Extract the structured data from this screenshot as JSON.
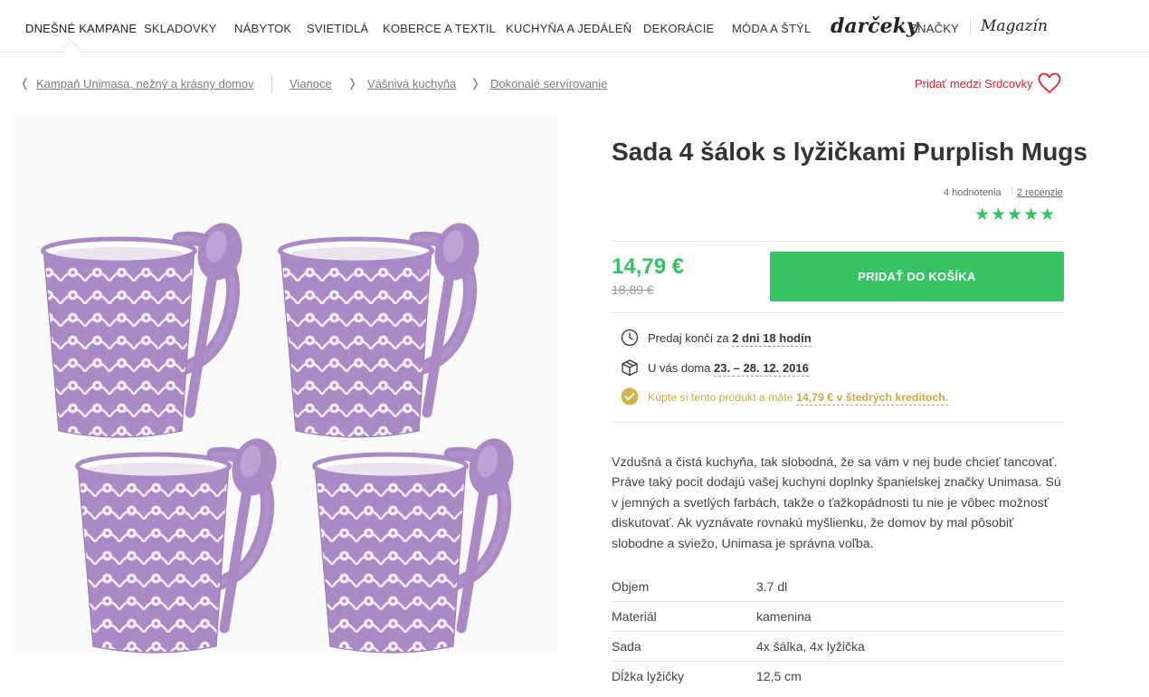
{
  "nav": {
    "items": [
      {
        "label": "DNEŠNÉ KAMPANE"
      },
      {
        "label": "SKLADOVKY"
      },
      {
        "label": "NÁBYTOK"
      },
      {
        "label": "SVIETIDLÁ"
      },
      {
        "label": "KOBERCE A TEXTIL"
      },
      {
        "label": "KUCHYŇA A JEDÁLEŇ"
      },
      {
        "label": "DEKORÁCIE"
      },
      {
        "label": "MÓDA A ŠTÝL"
      },
      {
        "label": "darčeky"
      },
      {
        "label": "ZNAČKY"
      },
      {
        "label": "Magazín"
      }
    ]
  },
  "breadcrumb": {
    "items": [
      {
        "label": "Kampaň Unimasa, nežný a krásny domov"
      },
      {
        "label": "Vianoce"
      },
      {
        "label": "Vášnivá kuchyňa"
      },
      {
        "label": "Dokonalé servírovanie"
      }
    ],
    "favorite_label": "Pridať medzi Srdcovky"
  },
  "product": {
    "title": "Sada 4 šálok s lyžičkami Purplish Mugs",
    "rating_count": "4 hodnotenia",
    "reviews_link": "2 recenzie",
    "stars": "★★★★★",
    "price": "14,79 €",
    "old_price": "18,89 €",
    "cart_label": "PRIDAŤ DO KOŠÍKA",
    "info": {
      "sale_prefix": "Predaj končí za",
      "sale_value": "2 dni 18 hodín",
      "delivery_prefix": "U vás doma",
      "delivery_value": "23. – 28. 12. 2016",
      "credit_prefix": "Kúpte si tento produkt a máte",
      "credit_value": "14,79 € v štedrých kreditoch."
    },
    "description": "Vzdušná a čistá kuchyňa, tak slobodná, že sa vám v nej bude chcieť tancovať. Práve taký pocit dodajú vašej kuchyni doplnky španielskej značky Unimasa. Sú v jemných a svetlých farbách, takže o ťažkopádnosti tu nie je vôbec možnosť diskutovať. Ak vyznávate rovnakú myšlienku, že domov by mal pôsobiť slobodne a sviežo, Unimasa je správna voľba.",
    "specs": [
      {
        "label": "Objem",
        "value": "3.7 dl"
      },
      {
        "label": "Materiál",
        "value": "kamenina"
      },
      {
        "label": "Sada",
        "value": "4x šálka, 4x lyžička"
      },
      {
        "label": "Dĺžka lyžičky",
        "value": "12,5 cm"
      }
    ]
  },
  "colors": {
    "accent_green": "#37c364",
    "favorite_red": "#e0202a",
    "credit_gold": "#c9a93e",
    "mug_purple": "#a98ac4"
  }
}
